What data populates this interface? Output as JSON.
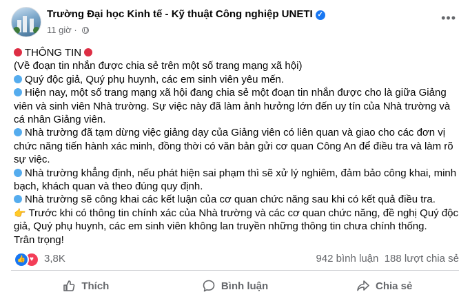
{
  "post": {
    "page_name": "Trường Đại học Kinh tế - Kỹ thuật Công nghiệp UNETI",
    "time": "11 giờ",
    "paragraphs": [
      {
        "prefix": "none",
        "text": ""
      },
      {
        "text": "(Về đoạn tin nhắn được chia sẻ trên một số trang mạng xã hội)"
      },
      {
        "text": "Quý độc giả, Quý phụ huynh, các em sinh viên yêu mến."
      },
      {
        "text": "Hiện nay, một số trang mạng xã hội đang chia sẻ một đoạn tin nhắn được cho là giữa Giảng viên và sinh viên Nhà trường. Sự việc này đã làm ảnh hưởng lớn đến uy tín của Nhà trường và cá nhân Giảng viên."
      },
      {
        "text": "Nhà trường đã tạm dừng việc giảng dạy của Giảng viên có liên quan và giao cho các đơn vị chức năng tiến hành xác minh, đồng thời có văn bản gửi cơ quan Công An để điều tra và làm rõ sự việc."
      },
      {
        "text": "Nhà trường khẳng định, nếu phát hiện sai phạm thì sẽ xử lý nghiêm, đảm bảo công khai, minh bạch, khách quan và theo đúng quy định."
      },
      {
        "text": "Nhà trường sẽ công khai các kết luận của cơ quan chức năng sau khi có kết quả điều tra."
      },
      {
        "text": "Trước khi có thông tin chính xác của Nhà trường và các cơ quan chức năng, đề nghị Quý độc giả, Quý phụ huynh, các em sinh viên không lan truyền những thông tin chưa chính thống."
      },
      {
        "text": "Trân trọng!"
      }
    ],
    "headline": "THÔNG TIN"
  },
  "stats": {
    "reactions": "3,8K",
    "comments": "942 bình luận",
    "shares": "188 lượt chia sẻ"
  },
  "actions": {
    "like": "Thích",
    "comment": "Bình luận",
    "share": "Chia sẻ"
  },
  "colors": {
    "brand_blue": "#1877f2",
    "love_red": "#f33e58",
    "secondary_text": "#65676b"
  }
}
